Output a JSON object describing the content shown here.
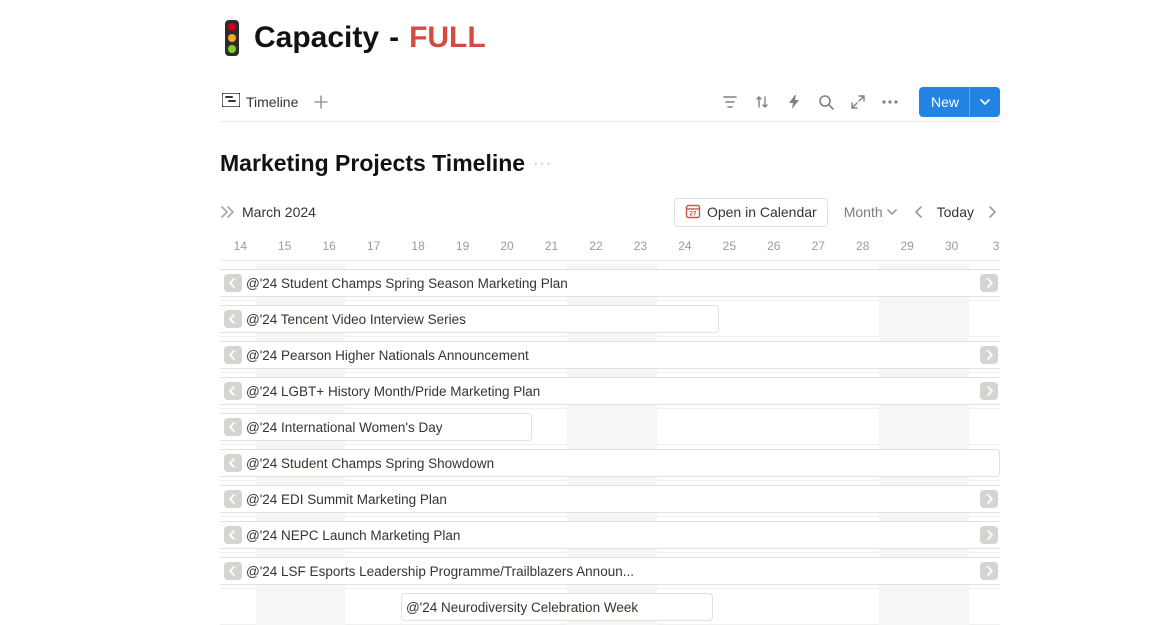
{
  "title": {
    "main": "Capacity",
    "dash": "-",
    "status": "FULL"
  },
  "toolbar": {
    "view_tab": "Timeline",
    "new_label": "New"
  },
  "section": {
    "title": "Marketing Projects Timeline"
  },
  "timeline": {
    "month_label": "March 2024",
    "open_calendar": "Open in Calendar",
    "scale_label": "Month",
    "today_label": "Today",
    "dates": [
      "14",
      "15",
      "16",
      "17",
      "18",
      "19",
      "20",
      "21",
      "22",
      "23",
      "24",
      "25",
      "26",
      "27",
      "28",
      "29",
      "30",
      "3"
    ],
    "date_positions_pct": [
      2.6,
      8.3,
      14.0,
      19.7,
      25.4,
      31.1,
      36.8,
      42.5,
      48.2,
      53.9,
      59.6,
      65.3,
      71.0,
      76.7,
      82.4,
      88.1,
      93.8,
      99.5
    ],
    "weekend_ranges_pct": [
      [
        4.6,
        16.0
      ],
      [
        44.5,
        56.0
      ],
      [
        84.5,
        96.0
      ]
    ],
    "rows": [
      {
        "label": "@'24 Student Champs Spring Season Marketing Plan",
        "start_pct": 0,
        "width_pct": 100,
        "arrow_left": true,
        "arrow_right": true,
        "show_left_chip": true
      },
      {
        "label": "@'24 Tencent Video Interview Series",
        "start_pct": 0,
        "width_pct": 64,
        "arrow_left": true,
        "arrow_right": false,
        "show_left_chip": true
      },
      {
        "label": "@'24 Pearson Higher Nationals Announcement",
        "start_pct": 0,
        "width_pct": 100,
        "arrow_left": true,
        "arrow_right": true,
        "show_left_chip": true
      },
      {
        "label": "@'24 LGBT+ History Month/Pride Marketing Plan",
        "start_pct": 0,
        "width_pct": 100,
        "arrow_left": true,
        "arrow_right": true,
        "show_left_chip": true
      },
      {
        "label": "@'24 International Women's Day",
        "start_pct": 0,
        "width_pct": 40,
        "arrow_left": true,
        "arrow_right": false,
        "show_left_chip": true
      },
      {
        "label": "@'24 Student Champs Spring Showdown",
        "start_pct": 0,
        "width_pct": 100,
        "arrow_left": true,
        "arrow_right": false,
        "show_left_chip": true
      },
      {
        "label": "@'24 EDI Summit Marketing Plan",
        "start_pct": 0,
        "width_pct": 100,
        "arrow_left": true,
        "arrow_right": true,
        "show_left_chip": true
      },
      {
        "label": "@'24 NEPC Launch Marketing Plan",
        "start_pct": 0,
        "width_pct": 100,
        "arrow_left": true,
        "arrow_right": true,
        "show_left_chip": true
      },
      {
        "label": "@'24 LSF Esports Leadership Programme/Trailblazers Announ...",
        "start_pct": 0,
        "width_pct": 100,
        "arrow_left": true,
        "arrow_right": true,
        "show_left_chip": true
      },
      {
        "label": "@'24 Neurodiversity Celebration Week",
        "start_pct": 23.2,
        "width_pct": 40,
        "arrow_left": false,
        "arrow_right": false,
        "show_left_chip": false
      }
    ]
  }
}
